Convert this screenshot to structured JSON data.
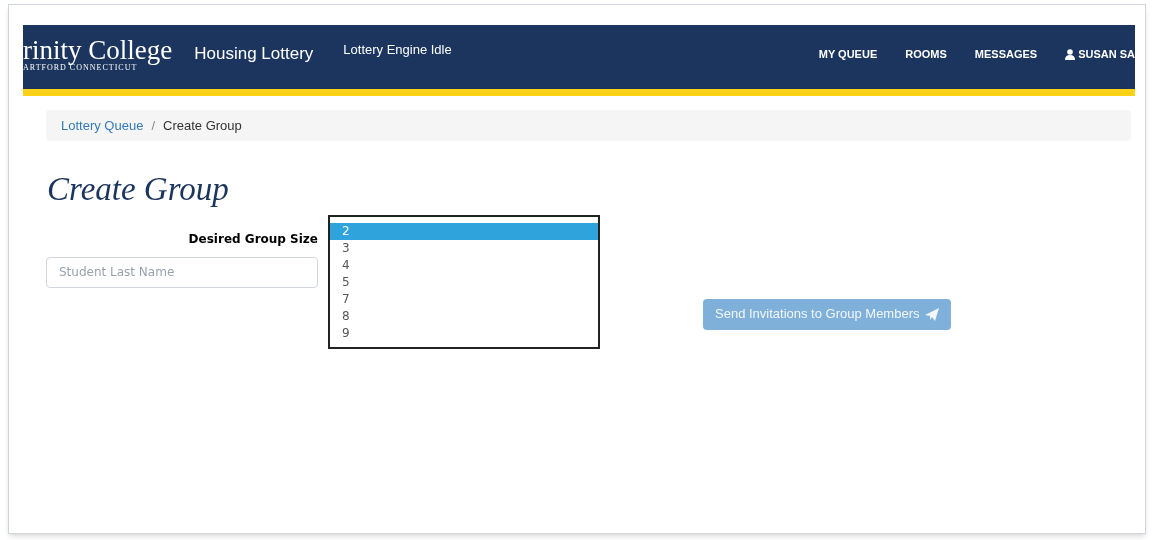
{
  "navbar": {
    "logo": "rinity College",
    "logo_subtitle": "ARTFORD CONNECTICUT",
    "app_title": "Housing Lottery",
    "engine_status": "Lottery Engine Idle",
    "links": [
      {
        "label": "MY QUEUE",
        "kind": "text"
      },
      {
        "label": "ROOMS",
        "kind": "text"
      },
      {
        "label": "MESSAGES",
        "kind": "text"
      },
      {
        "label": "SUSAN SA",
        "kind": "user"
      }
    ]
  },
  "breadcrumb_separator": "/",
  "breadcrumb": [
    {
      "label": "Lottery Queue",
      "kind": "link"
    },
    {
      "label": "Create Group",
      "kind": "current"
    }
  ],
  "heading": "Create Group",
  "form": {
    "group_size_label": "Desired Group Size",
    "group_size_options": [
      {
        "label": "2",
        "selected": true
      },
      {
        "label": "3",
        "selected": false
      },
      {
        "label": "4",
        "selected": false
      },
      {
        "label": "5",
        "selected": false
      },
      {
        "label": "7",
        "selected": false
      },
      {
        "label": "8",
        "selected": false
      },
      {
        "label": "9",
        "selected": false
      }
    ],
    "last_name": {
      "placeholder": "Student Last Name"
    },
    "send_button": {
      "label": "Send Invitations to Group Members",
      "disabled": true
    }
  }
}
